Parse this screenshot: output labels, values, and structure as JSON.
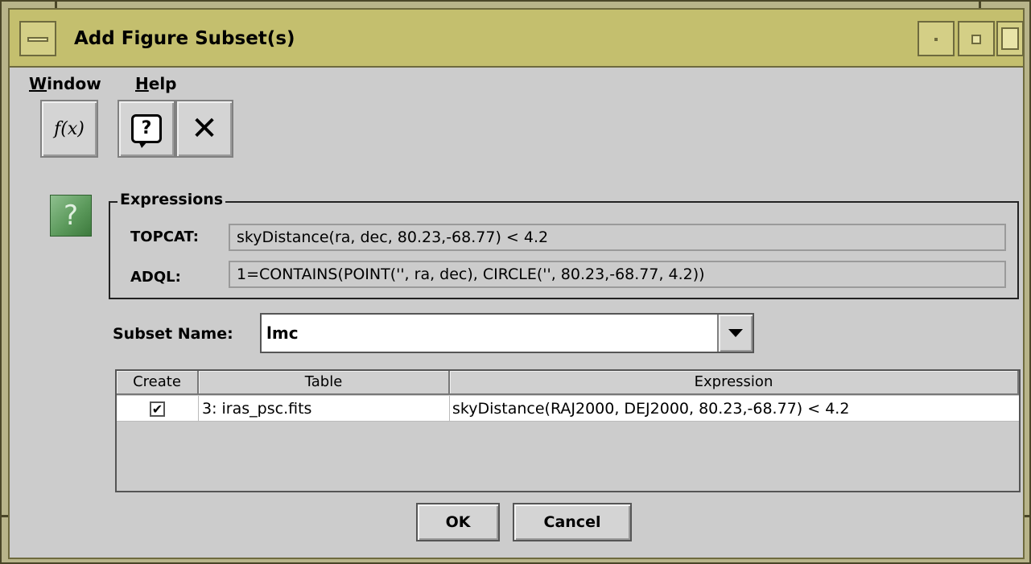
{
  "window": {
    "title": "Add Figure Subset(s)",
    "frame_color": "#b8b48a",
    "titlebar_color": "#c4bf6e"
  },
  "menubar": {
    "items": [
      {
        "label_mn": "W",
        "label_rest": "indow"
      },
      {
        "label_mn": "H",
        "label_rest": "elp"
      }
    ]
  },
  "toolbar": {
    "fx_label": "f(x)",
    "help_glyph": "?",
    "close_glyph": "✕",
    "icons": [
      "function-icon",
      "help-icon",
      "close-icon"
    ]
  },
  "expressions": {
    "help_glyph": "?",
    "group_title": "Expressions",
    "topcat_label": "TOPCAT:",
    "topcat_value": "skyDistance(ra, dec, 80.23,-68.77) < 4.2",
    "adql_label": "ADQL:",
    "adql_value": "1=CONTAINS(POINT('', ra, dec), CIRCLE('', 80.23,-68.77, 4.2))"
  },
  "subset": {
    "label": "Subset Name:",
    "value": "lmc"
  },
  "table": {
    "columns": [
      "Create",
      "Table",
      "Expression"
    ],
    "rows": [
      {
        "create": true,
        "check_glyph": "✔",
        "table": "3: iras_psc.fits",
        "expression": "skyDistance(RAJ2000, DEJ2000, 80.23,-68.77) < 4.2"
      }
    ]
  },
  "buttons": {
    "ok": "OK",
    "cancel": "Cancel"
  }
}
